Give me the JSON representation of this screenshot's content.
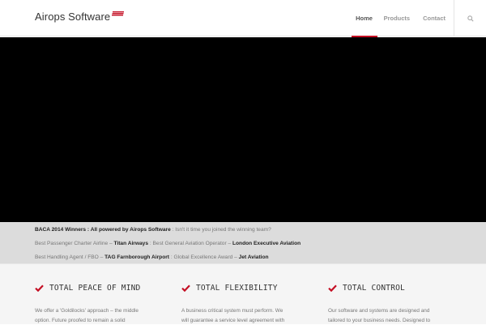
{
  "header": {
    "logo_text": "Airops Software",
    "nav": [
      {
        "label": "Home",
        "active": true
      },
      {
        "label": "Products",
        "active": false
      },
      {
        "label": "Contact",
        "active": false
      }
    ]
  },
  "awards": {
    "line1": {
      "bold": "BACA 2014 Winners : All powered by Airops Software",
      "text": " : Isn't it time you joined the winning team?"
    },
    "line2": {
      "t1": "Best Passenger Charter Airline – ",
      "b1": "Titan Airways",
      "t2": " : Best General Aviation Operator – ",
      "b2": "London Executive Aviation"
    },
    "line3": {
      "t1": "Best Handling Agent / FBO – ",
      "b1": "TAG Farnborough Airport",
      "t2": " : Global Excellence Award – ",
      "b2": "Jet Aviation"
    }
  },
  "features": [
    {
      "title": "TOTAL PEACE OF MIND",
      "body_line1": "We offer a 'Goldilocks' approach – the middle",
      "body_line2": "option.  Future proofed to remain a solid"
    },
    {
      "title": "TOTAL FLEXIBILITY",
      "body_line1": "A business critical system must perform.  We",
      "body_line2": "will guarantee a service level agreement with"
    },
    {
      "title": "TOTAL CONTROL",
      "body_line1": "Our software and systems are designed and",
      "body_line2": "tailored to your business needs. Designed to"
    }
  ],
  "colors": {
    "accent": "#c40e23",
    "check": "#c40e23"
  }
}
